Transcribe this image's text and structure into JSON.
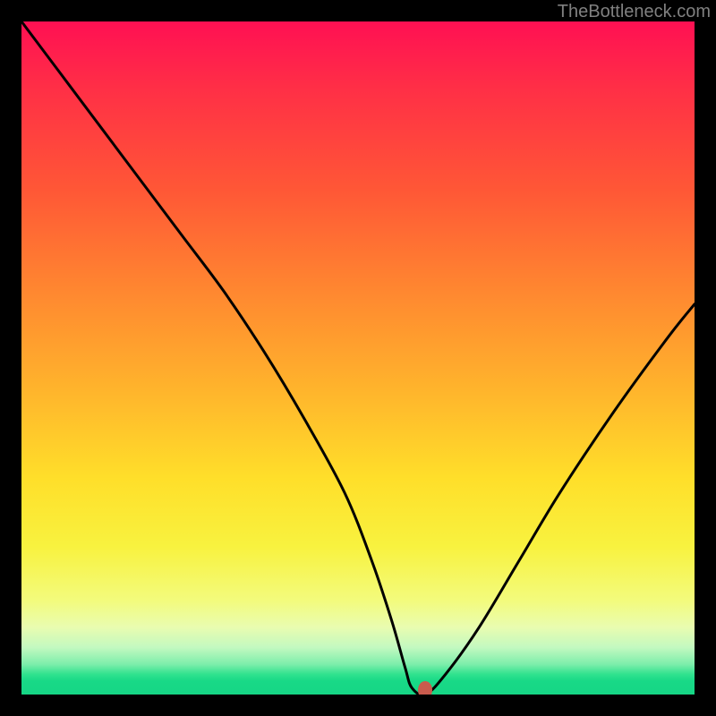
{
  "watermark": "TheBottleneck.com",
  "colors": {
    "frame": "#000000",
    "curve": "#000000",
    "marker": "#c95b4d"
  },
  "chart_data": {
    "type": "line",
    "title": "",
    "xlabel": "",
    "ylabel": "",
    "xlim": [
      0,
      100
    ],
    "ylim": [
      0,
      100
    ],
    "grid": false,
    "legend": false,
    "series": [
      {
        "name": "bottleneck-curve",
        "x": [
          0,
          6,
          12,
          18,
          24,
          30,
          36,
          42,
          48,
          52,
          55,
          57,
          58,
          60,
          63,
          68,
          74,
          80,
          88,
          96,
          100
        ],
        "values": [
          100,
          92,
          84,
          76,
          68,
          60,
          51,
          41,
          30,
          20,
          11,
          4,
          1,
          0,
          3,
          10,
          20,
          30,
          42,
          53,
          58
        ]
      }
    ],
    "annotations": [
      {
        "name": "optimal-marker",
        "x": 60,
        "y": 0.6,
        "shape": "ellipse",
        "color": "#c95b4d"
      }
    ]
  }
}
